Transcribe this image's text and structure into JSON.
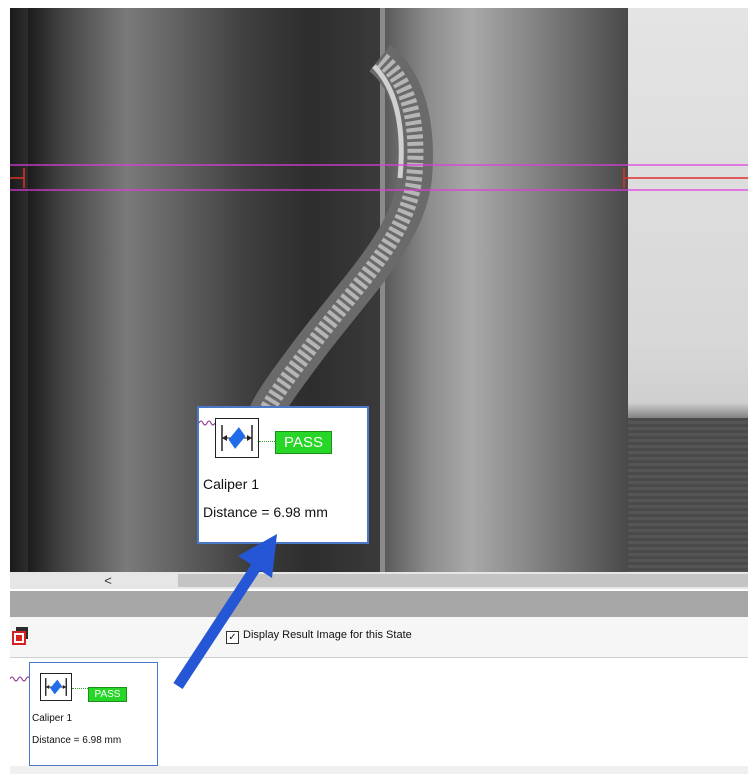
{
  "viewer": {
    "scroll_left_glyph": "<"
  },
  "result_popup": {
    "status": "PASS",
    "tool_name": "Caliper 1",
    "measurement": "Distance = 6.98 mm"
  },
  "toolbar": {
    "checkbox_checked": true,
    "checkbox_glyph": "✓",
    "checkbox_label": "Display Result Image for this State"
  },
  "result_small": {
    "status": "PASS",
    "tool_name": "Caliper 1",
    "measurement": "Distance = 6.98 mm"
  },
  "colors": {
    "pass_green": "#27d627",
    "selection_blue": "#4a78c8",
    "roi_magenta": "#e23be2",
    "edge_red": "#e0302a",
    "callout_arrow": "#2456d6"
  },
  "icons": {
    "caliper_tool": "caliper-icon",
    "toolbar_result": "result-image-icon"
  }
}
